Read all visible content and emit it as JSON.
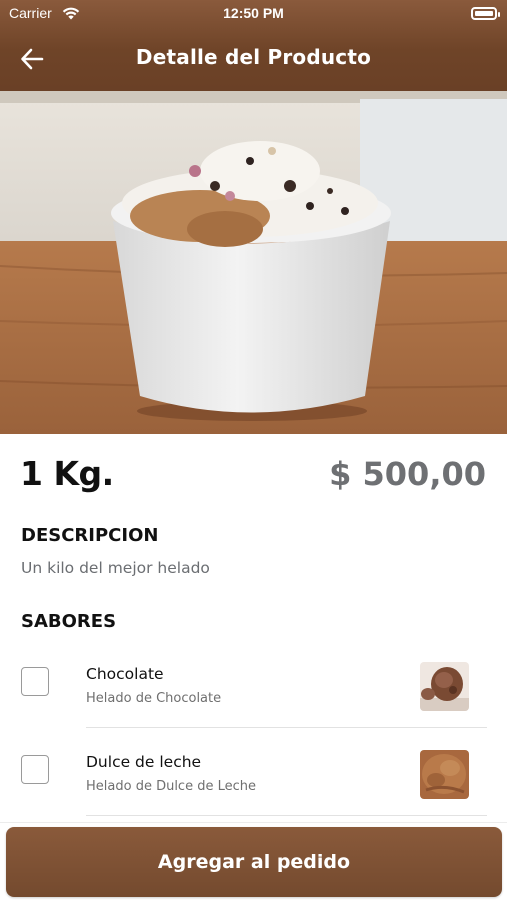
{
  "status_bar": {
    "carrier": "Carrier",
    "time": "12:50 PM",
    "battery_level": 1.0
  },
  "nav": {
    "title": "Detalle del Producto",
    "back_icon": "arrow-left-icon"
  },
  "product": {
    "image_icon": "ice-cream-cup-photo",
    "name": "1 Kg.",
    "price": "$ 500,00"
  },
  "description": {
    "title": "DESCRIPCION",
    "text": "Un kilo del mejor helado"
  },
  "flavors": {
    "title": "SABORES",
    "items": [
      {
        "name": "Chocolate",
        "subtitle": "Helado de Chocolate",
        "checked": false,
        "thumb": "chocolate-ice-cream-thumb"
      },
      {
        "name": "Dulce de leche",
        "subtitle": "Helado de Dulce de Leche",
        "checked": false,
        "thumb": "dulce-de-leche-ice-cream-thumb"
      }
    ]
  },
  "actions": {
    "add_to_order": "Agregar al pedido"
  },
  "colors": {
    "brand": "#7a4d30",
    "price": "#6e7073",
    "muted": "#6b6e72"
  }
}
